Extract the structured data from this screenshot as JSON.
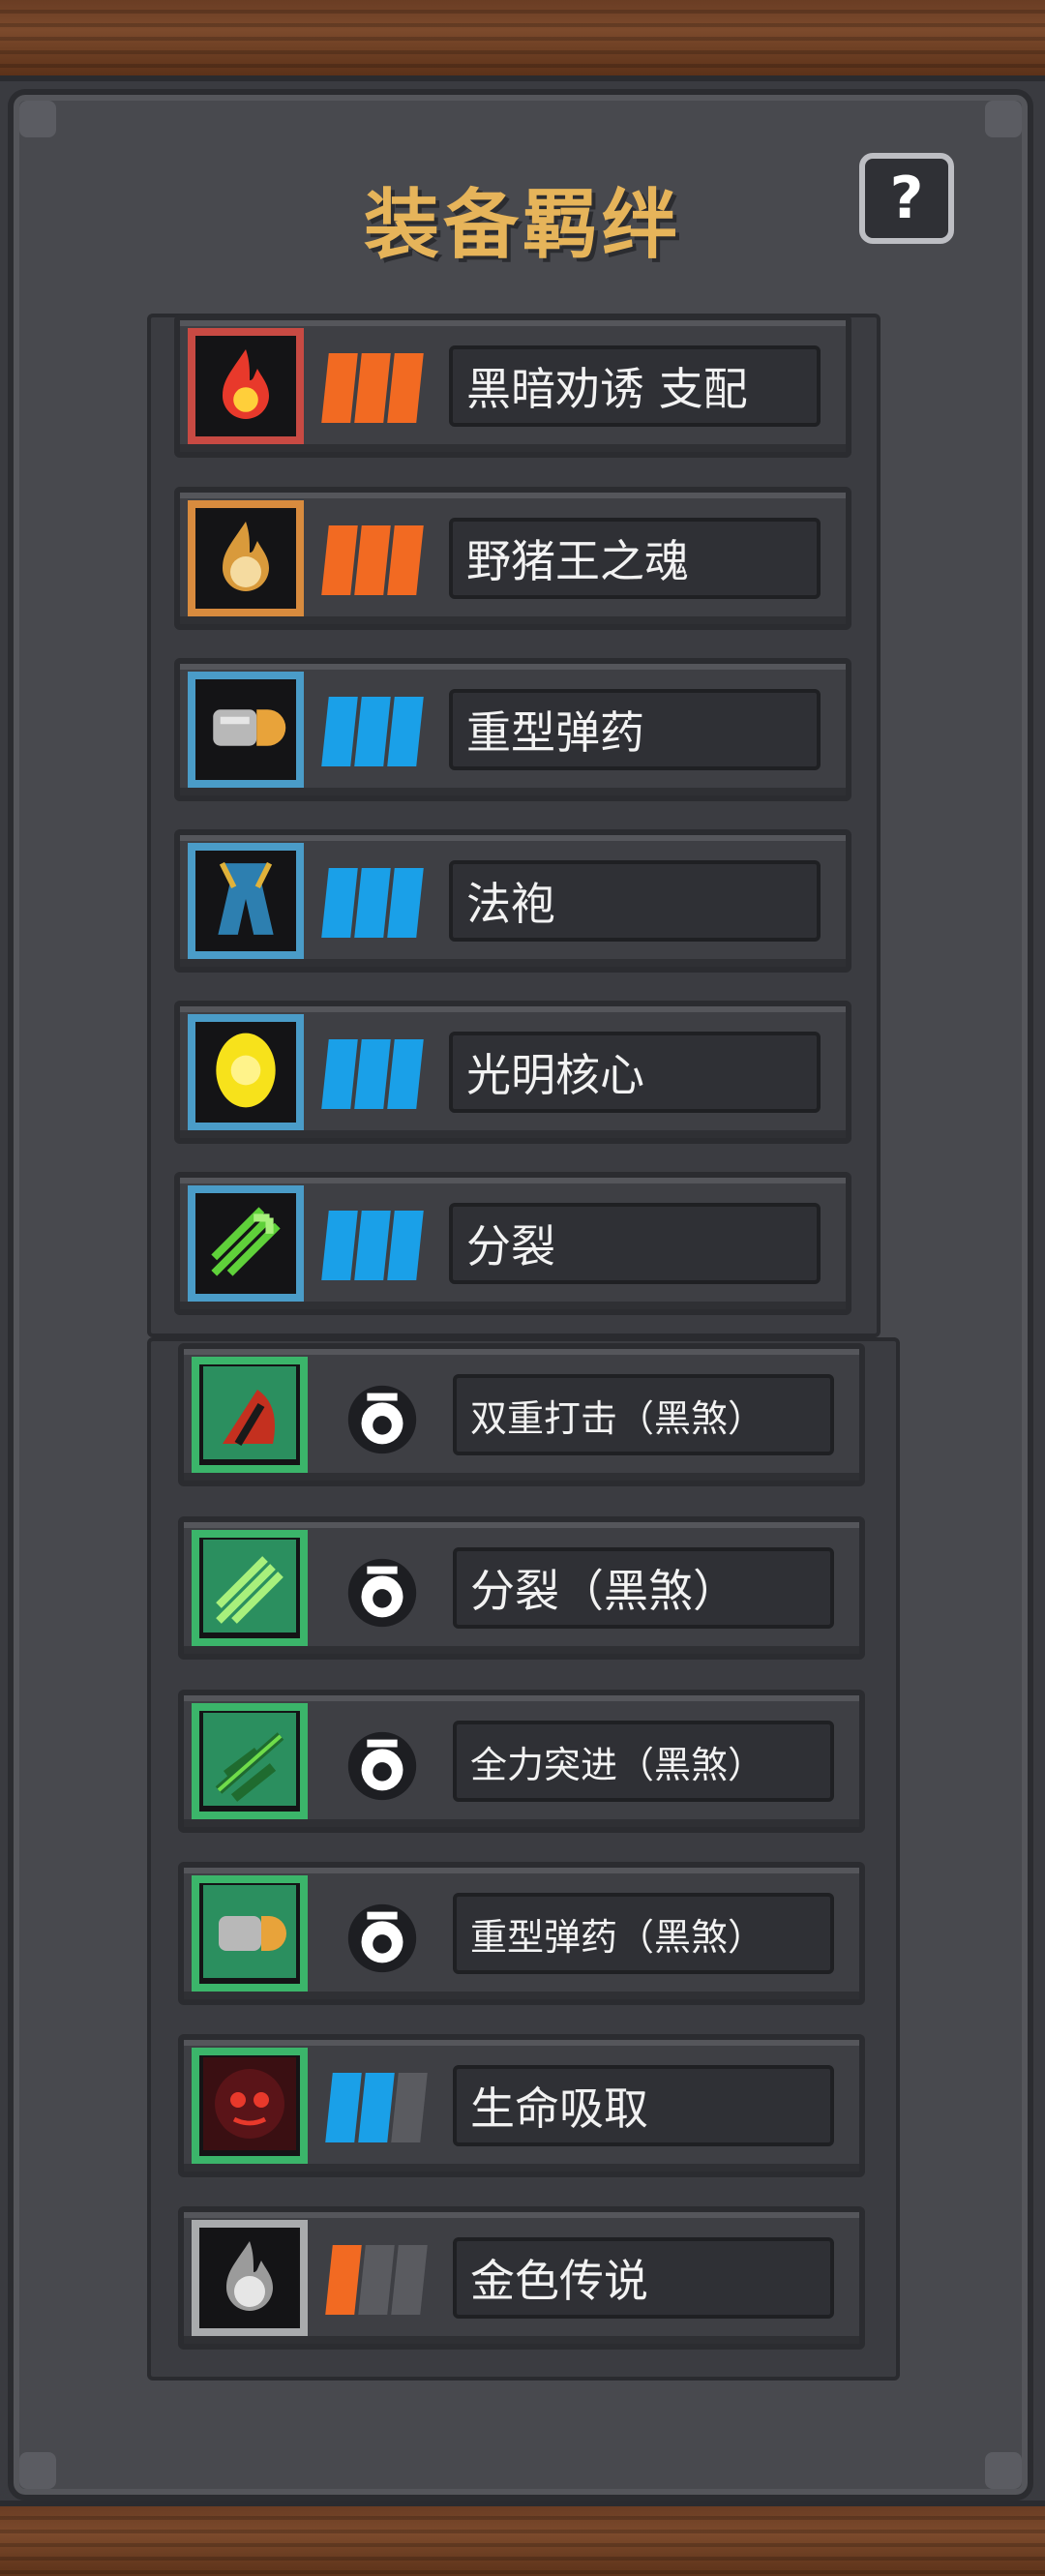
{
  "title": "装备羁绊",
  "help_label": "?",
  "colors": {
    "tier_orange": "#f26a22",
    "tier_blue": "#1aa0e8",
    "tier_empty": "#5a5b60",
    "frame_red": "#c84a43",
    "frame_orange": "#d88b3e",
    "frame_blue": "#4a9cc8",
    "frame_green": "#3bb56a",
    "frame_gray": "#a9abad",
    "title_gold": "#e6b45a"
  },
  "bonds": [
    {
      "name": "黑暗劝诱 支配",
      "icon": "red-flame-icon",
      "frame": "#c84a43",
      "tier_color": "#f26a22",
      "tier_filled": 3
    },
    {
      "name": "野猪王之魂",
      "icon": "boar-spirit-flame-icon",
      "frame": "#d88b3e",
      "tier_color": "#f26a22",
      "tier_filled": 3
    },
    {
      "name": "重型弹药",
      "icon": "bullet-icon",
      "frame": "#4a9cc8",
      "tier_color": "#1aa0e8",
      "tier_filled": 3
    },
    {
      "name": "法袍",
      "icon": "robe-icon",
      "frame": "#4a9cc8",
      "tier_color": "#1aa0e8",
      "tier_filled": 3
    },
    {
      "name": "光明核心",
      "icon": "light-core-icon",
      "frame": "#4a9cc8",
      "tier_color": "#1aa0e8",
      "tier_filled": 3
    },
    {
      "name": "分裂",
      "icon": "split-arrows-icon",
      "frame": "#4a9cc8",
      "tier_color": "#1aa0e8",
      "tier_filled": 3
    },
    {
      "name": "双重打击（黑煞）",
      "icon": "double-strike-dark-icon",
      "frame": "#3bb56a",
      "badge": "dark-eye-icon"
    },
    {
      "name": "分裂（黑煞）",
      "icon": "split-dark-icon",
      "frame": "#3bb56a",
      "badge": "dark-eye-icon"
    },
    {
      "name": "全力突进（黑煞）",
      "icon": "full-charge-dark-icon",
      "frame": "#3bb56a",
      "badge": "dark-eye-icon"
    },
    {
      "name": "重型弹药（黑煞）",
      "icon": "bullet-dark-icon",
      "frame": "#3bb56a",
      "badge": "dark-eye-icon"
    },
    {
      "name": "生命吸取",
      "icon": "life-drain-icon",
      "frame": "#3bb56a",
      "tier_color": "#1aa0e8",
      "tier_filled": 2
    },
    {
      "name": "金色传说",
      "icon": "gold-legend-flame-icon",
      "frame": "#a9abad",
      "tier_color": "#f26a22",
      "tier_filled": 1
    }
  ]
}
